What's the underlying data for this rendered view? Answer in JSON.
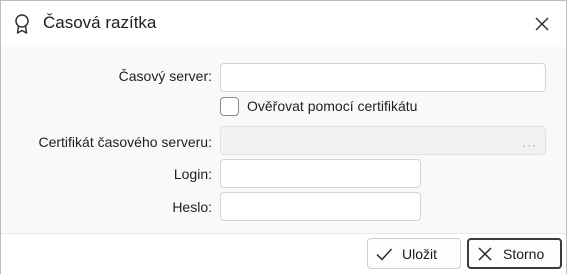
{
  "window": {
    "title": "Časová razítka",
    "title_icon": "award-ribbon-icon",
    "close_icon": "close-icon"
  },
  "form": {
    "time_server_label": "Časový server:",
    "time_server_value": "",
    "verify_cert_label": "Ověřovat pomocí certifikátu",
    "verify_cert_checked": false,
    "server_cert_label": "Certifikát časového serveru:",
    "server_cert_value": "",
    "server_cert_disabled": true,
    "browse_icon": "ellipsis-icon",
    "browse_glyph": "···",
    "login_label": "Login:",
    "login_value": "",
    "password_label": "Heslo:",
    "password_value": ""
  },
  "footer": {
    "save_label": "Uložit",
    "save_icon": "checkmark-icon",
    "cancel_label": "Storno",
    "cancel_icon": "x-icon"
  }
}
